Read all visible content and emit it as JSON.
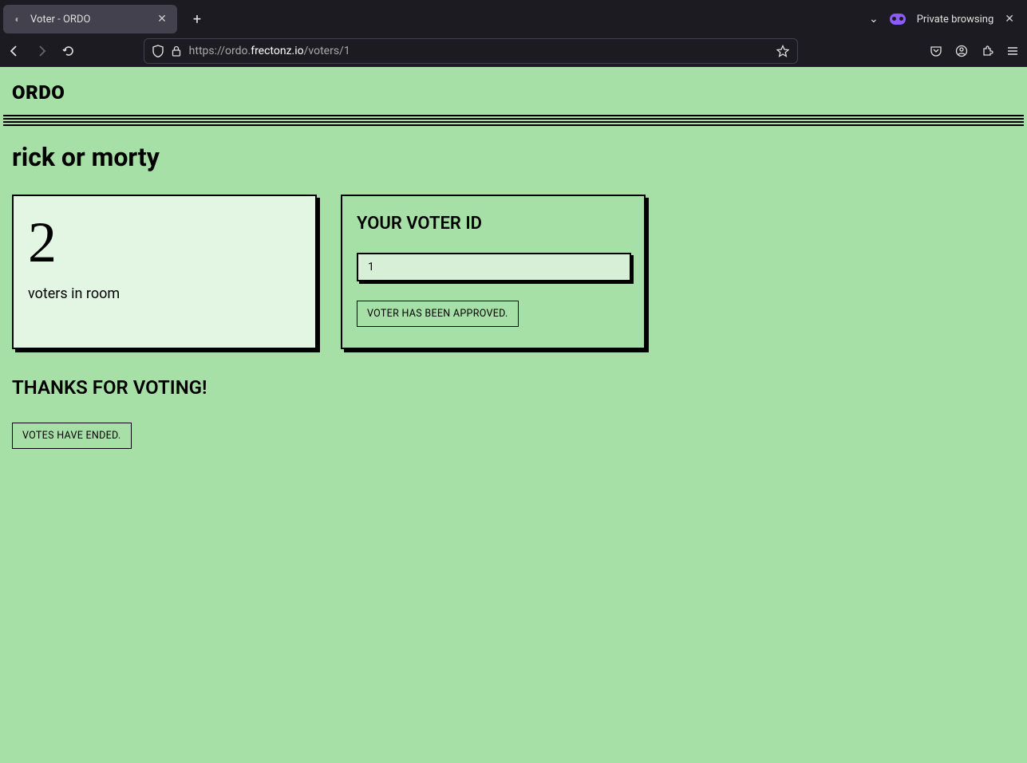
{
  "browser": {
    "tab_title": "Voter - ORDO",
    "private_label": "Private browsing",
    "url_prefix": "https://ordo.",
    "url_highlight": "frectonz.io",
    "url_suffix": "/voters/1"
  },
  "page": {
    "logo": "ORDO",
    "room_title": "rick or morty",
    "voters_card": {
      "count": "2",
      "label": "voters in room"
    },
    "voter_id_card": {
      "heading": "YOUR VOTER ID",
      "value": "1",
      "status": "VOTER HAS BEEN APPROVED."
    },
    "thanks": "THANKS FOR VOTING!",
    "ended": "VOTES HAVE ENDED."
  }
}
